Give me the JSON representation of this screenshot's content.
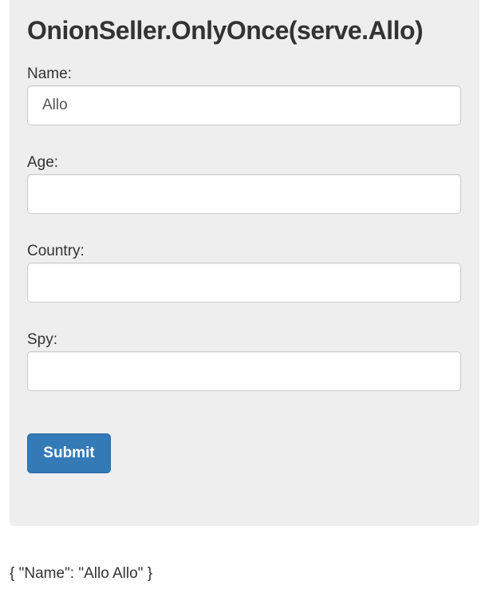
{
  "form": {
    "title": "OnionSeller.OnlyOnce(serve.Allo)",
    "fields": [
      {
        "label": "Name:",
        "value": "Allo",
        "placeholder": ""
      },
      {
        "label": "Age:",
        "value": "",
        "placeholder": ""
      },
      {
        "label": "Country:",
        "value": "",
        "placeholder": ""
      },
      {
        "label": "Spy:",
        "value": "",
        "placeholder": ""
      }
    ],
    "submit_label": "Submit"
  },
  "output": {
    "text": "{ \"Name\": \"Allo Allo\" }"
  },
  "colors": {
    "card_background": "#eeeeee",
    "button_primary": "#337ab7",
    "text": "#333333"
  }
}
